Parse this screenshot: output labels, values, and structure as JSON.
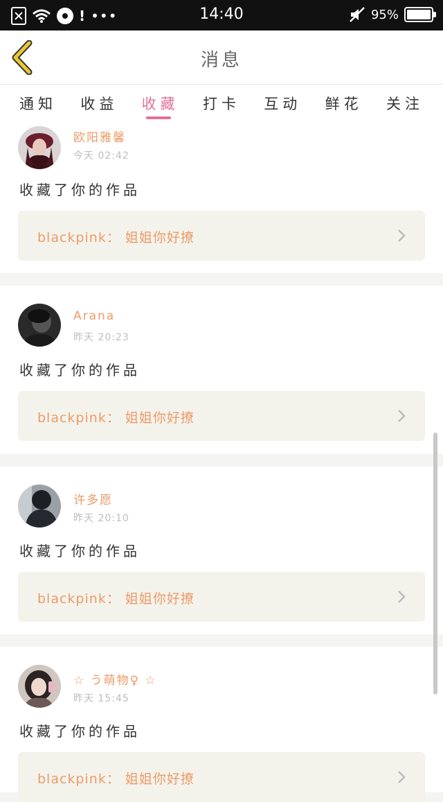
{
  "status_bar": {
    "time": "14:40",
    "battery": "95%",
    "notification_mark": "!",
    "dots": "•••"
  },
  "header": {
    "title": "消息"
  },
  "tabs": [
    {
      "label": "通知",
      "active": false
    },
    {
      "label": "收益",
      "active": false
    },
    {
      "label": "收藏",
      "active": true
    },
    {
      "label": "打卡",
      "active": false
    },
    {
      "label": "互动",
      "active": false
    },
    {
      "label": "鲜花",
      "active": false
    },
    {
      "label": "关注",
      "active": false
    }
  ],
  "items": [
    {
      "user": "欧阳雅馨",
      "time": "今天 02:42",
      "action": "收藏了你的作品",
      "work": "blackpink：  姐姐你好撩"
    },
    {
      "user": "Arana",
      "time": "昨天 20:23",
      "action": "收藏了你的作品",
      "work": "blackpink：  姐姐你好撩"
    },
    {
      "user": "许多愿",
      "time": "昨天 20:10",
      "action": "收藏了你的作品",
      "work": "blackpink：  姐姐你好撩"
    },
    {
      "user": "☆ う萌物♀ ☆",
      "time": "昨天 15:45",
      "action": "收藏了你的作品",
      "work": "blackpink：  姐姐你好撩"
    }
  ],
  "colors": {
    "accent_pink": "#e0709c",
    "name_orange": "#ee9a66",
    "back_yellow": "#e8c833",
    "work_bg": "#f3f3ec"
  },
  "icons": {
    "back": "chevron-left-icon",
    "item_arrow": "chevron-right-icon"
  }
}
